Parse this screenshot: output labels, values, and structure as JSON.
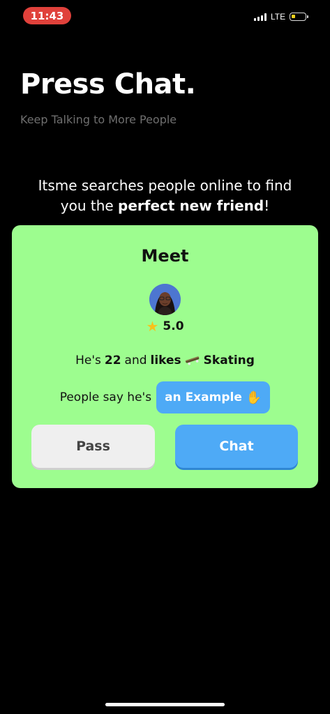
{
  "status_bar": {
    "time": "11:43",
    "network": "LTE",
    "battery_color": "#f2d21b",
    "time_pill_color": "#e0413b"
  },
  "header": {
    "title": "Press Chat.",
    "subtitle": "Keep Talking to More People"
  },
  "intro": {
    "line1": "Itsme searches people online to find",
    "line2_prefix": "you the ",
    "line2_bold": "perfect new friend",
    "line2_suffix": "!"
  },
  "card": {
    "background": "#9dfd8f",
    "heading": "Meet",
    "avatar_icon": "user-avatar",
    "star_icon": "star-icon",
    "rating": "5.0",
    "bio": {
      "prefix": "He's",
      "age": "22",
      "and": "and",
      "likes": "likes",
      "hobby_icon": "skateboard-icon",
      "hobby": "Skating"
    },
    "people_say": "People say he's",
    "trait": "an Example",
    "trait_icon": "waving-hand-icon",
    "pass_label": "Pass",
    "chat_label": "Chat",
    "accent": "#4eaaf6"
  }
}
